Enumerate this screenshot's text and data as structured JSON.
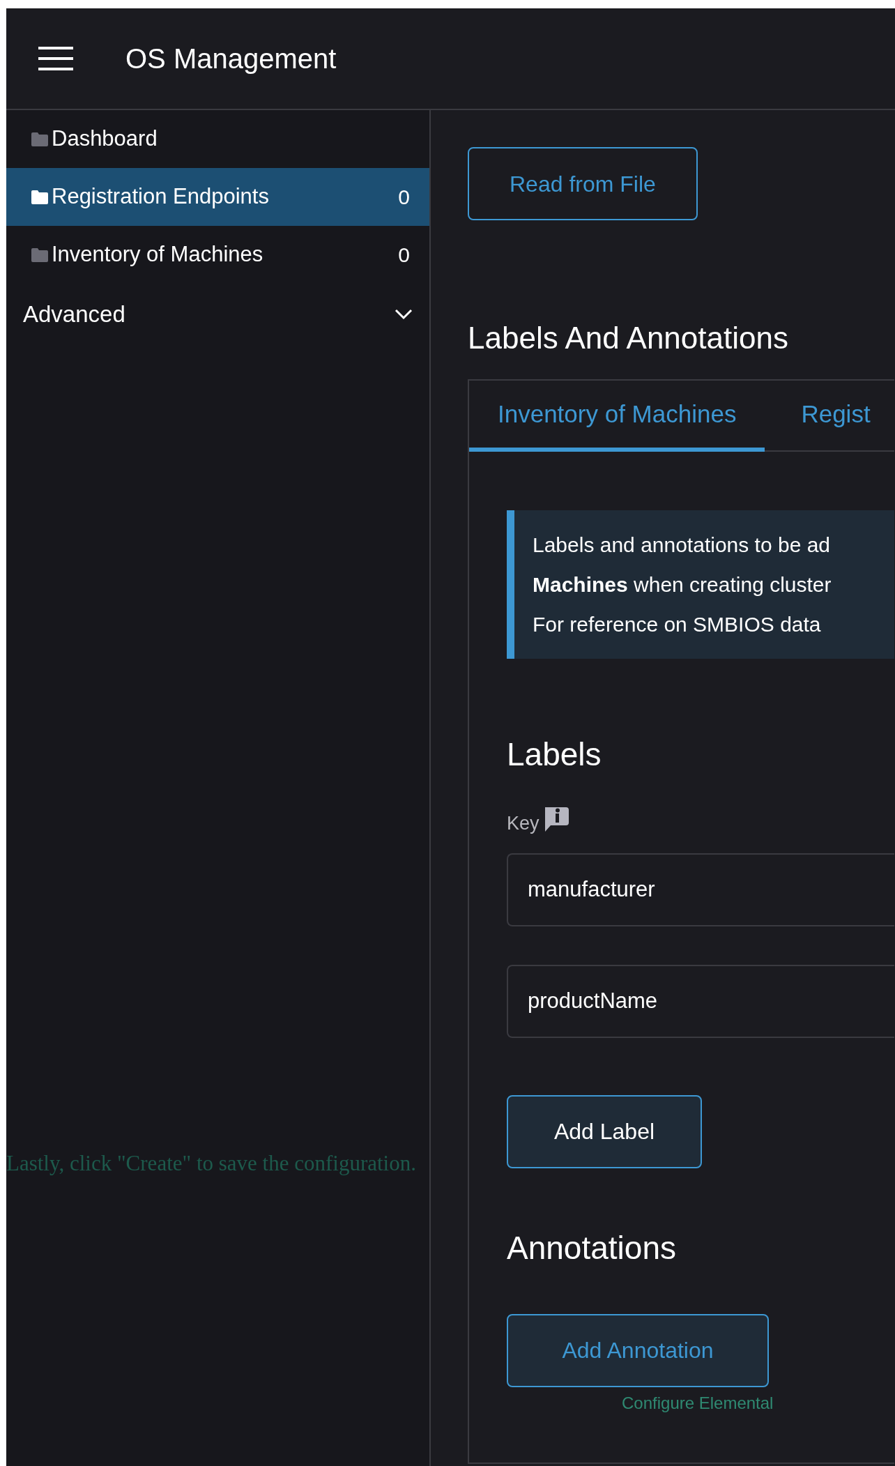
{
  "header": {
    "title": "OS Management"
  },
  "sidebar": {
    "items": [
      {
        "label": "Dashboard",
        "selected": false
      },
      {
        "label": "Registration Endpoints",
        "count": "0",
        "selected": true
      },
      {
        "label": "Inventory of Machines",
        "count": "0",
        "selected": false
      }
    ],
    "group": {
      "label": "Advanced",
      "expanded": false
    },
    "hint": "Lastly, click \"Create\" to save the configuration."
  },
  "main": {
    "read_button": "Read from File",
    "heading": "Labels And Annotations",
    "tabs": [
      {
        "label": "Inventory of Machines",
        "selected": true
      },
      {
        "label": "Regist",
        "selected": false
      }
    ],
    "info_lines": [
      "Labels and annotations to be ad",
      "**Machines** when creating cluster",
      "For reference on SMBIOS data"
    ],
    "labels_heading": "Labels",
    "key_label": "Key",
    "key_fields": [
      "manufacturer",
      "productName"
    ],
    "add_label_button": "Add Label",
    "annotations_heading": "Annotations",
    "add_annotation_button": "Add Annotation",
    "button_hint": "Configure Elemental"
  }
}
